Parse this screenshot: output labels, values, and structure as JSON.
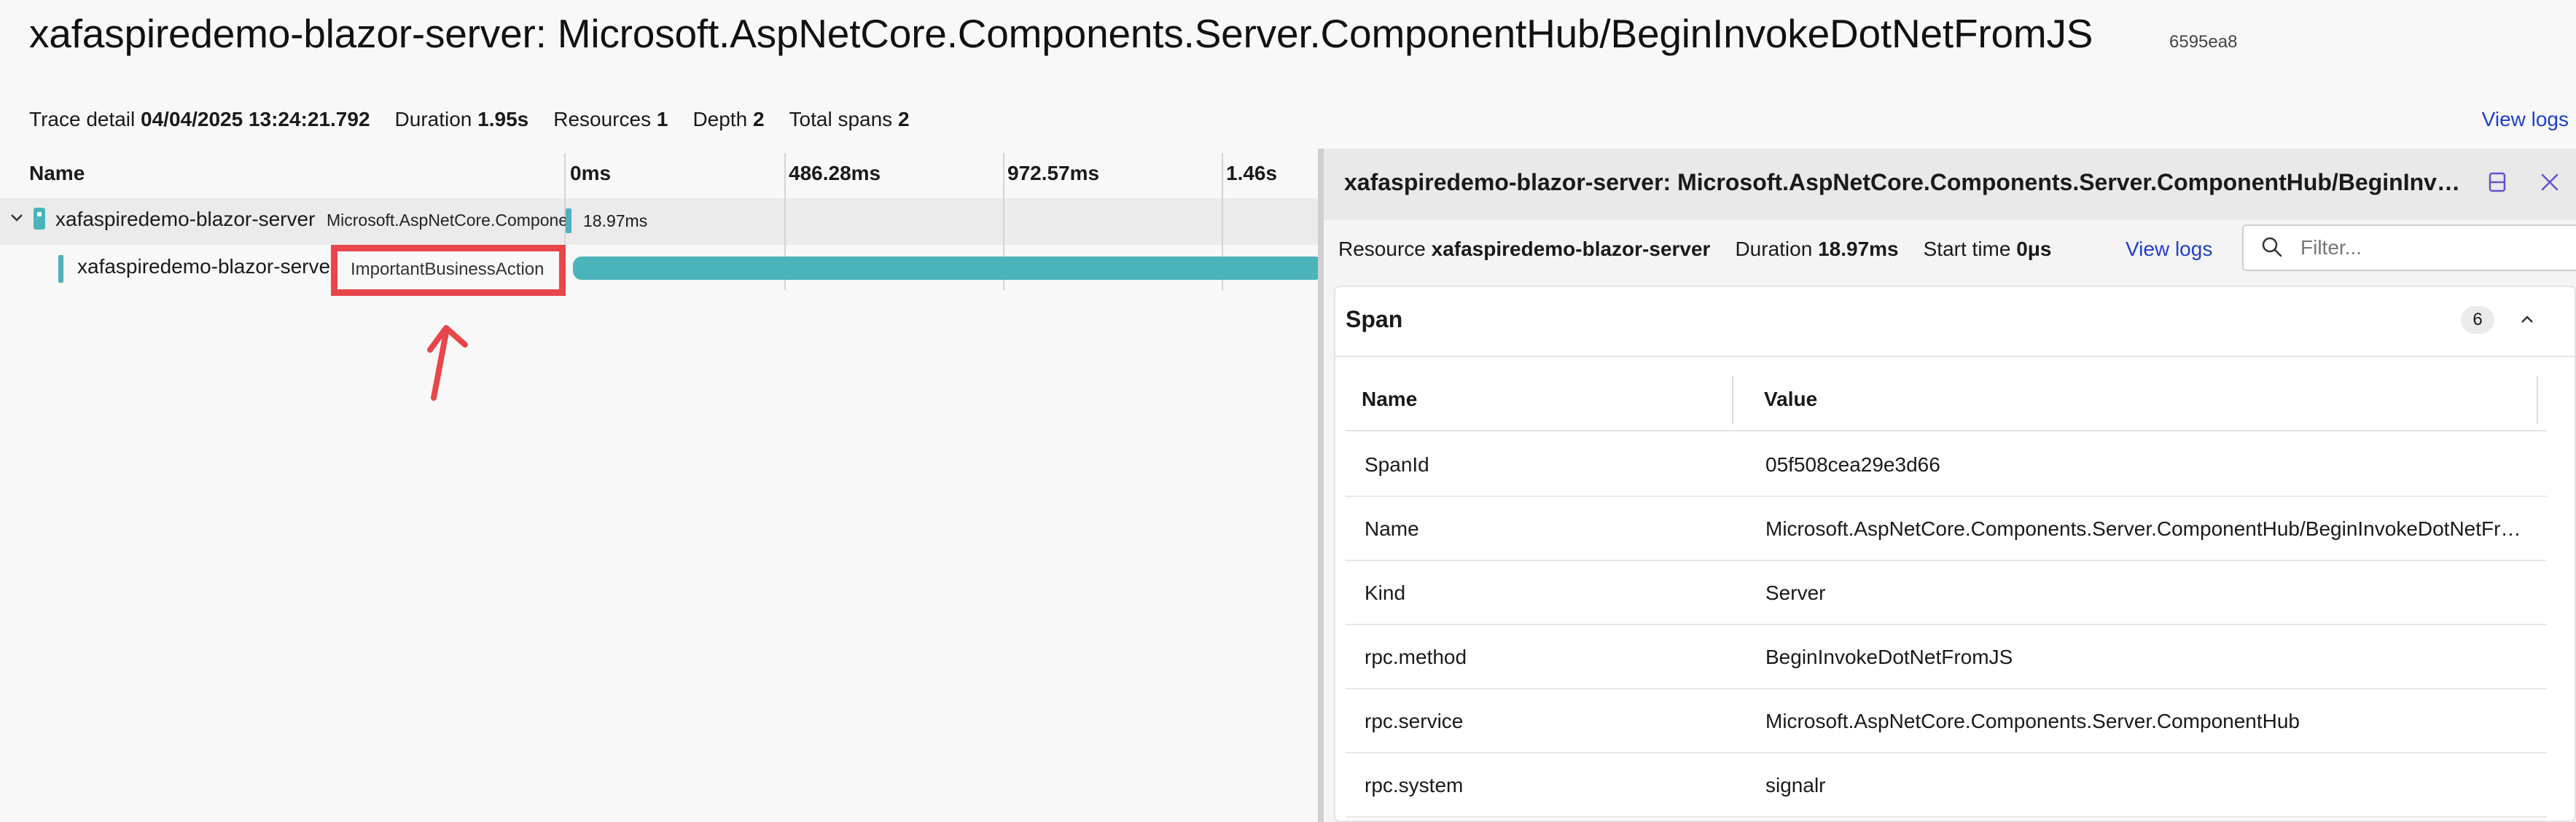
{
  "header": {
    "title": "xafaspiredemo-blazor-server: Microsoft.AspNetCore.Components.Server.ComponentHub/BeginInvokeDotNetFromJS",
    "trace_id": "6595ea8",
    "view_logs": "View logs"
  },
  "summary": {
    "trace_detail_label": "Trace detail",
    "trace_detail_value": "04/04/2025 13:24:21.792",
    "duration_label": "Duration",
    "duration_value": "1.95s",
    "resources_label": "Resources",
    "resources_value": "1",
    "depth_label": "Depth",
    "depth_value": "2",
    "total_spans_label": "Total spans",
    "total_spans_value": "2"
  },
  "grid": {
    "name_header": "Name",
    "ticks": [
      "0ms",
      "486.28ms",
      "972.57ms",
      "1.46s"
    ],
    "rows": [
      {
        "resource": "xafaspiredemo-blazor-server",
        "name": "Microsoft.AspNetCore.Components.Server.ComponentHub/BeginInvokeDotNetFromJS",
        "duration": "18.97ms"
      },
      {
        "resource": "xafaspiredemo-blazor-server",
        "name": "ImportantBusinessAction"
      }
    ]
  },
  "detail": {
    "title": "xafaspiredemo-blazor-server: Microsoft.AspNetCore.Components.Server.ComponentHub/BeginInvokeDotNetFromJS",
    "resource_label": "Resource",
    "resource_value": "xafaspiredemo-blazor-server",
    "duration_label": "Duration",
    "duration_value": "18.97ms",
    "start_time_label": "Start time",
    "start_time_value": "0μs",
    "view_logs": "View logs",
    "filter_placeholder": "Filter...",
    "span_section": {
      "title": "Span",
      "count": "6",
      "col_name": "Name",
      "col_value": "Value",
      "rows": [
        {
          "name": "SpanId",
          "value": "05f508cea29e3d66"
        },
        {
          "name": "Name",
          "value": "Microsoft.AspNetCore.Components.Server.ComponentHub/BeginInvokeDotNetFromJS"
        },
        {
          "name": "Kind",
          "value": "Server"
        },
        {
          "name": "rpc.method",
          "value": "BeginInvokeDotNetFromJS"
        },
        {
          "name": "rpc.service",
          "value": "Microsoft.AspNetCore.Components.Server.ComponentHub"
        },
        {
          "name": "rpc.system",
          "value": "signalr"
        }
      ]
    }
  },
  "colors": {
    "accent": "#4ab4ba",
    "highlight": "#e8464b",
    "link": "#1f3fcf"
  }
}
